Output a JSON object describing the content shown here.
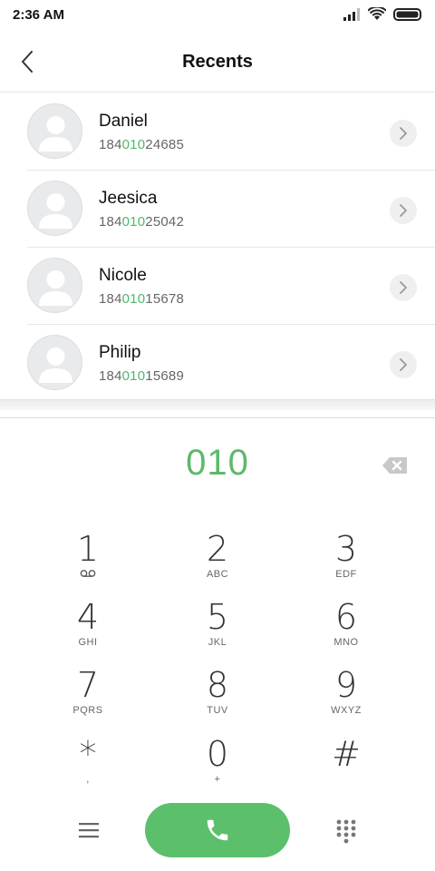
{
  "status": {
    "time": "2:36 AM",
    "icons": [
      "signal-icon",
      "wifi-icon",
      "battery-icon"
    ]
  },
  "header": {
    "title": "Recents",
    "back_icon": "chevron-left-icon"
  },
  "contacts": [
    {
      "name": "Daniel",
      "number_prefix": "184",
      "number_match": "010",
      "number_suffix": "24685"
    },
    {
      "name": "Jeesica",
      "number_prefix": "184",
      "number_match": "010",
      "number_suffix": "25042"
    },
    {
      "name": "Nicole",
      "number_prefix": "184",
      "number_match": "010",
      "number_suffix": "15678"
    },
    {
      "name": "Philip",
      "number_prefix": "184",
      "number_match": "010",
      "number_suffix": "15689"
    }
  ],
  "dialer": {
    "input": "010",
    "backspace_icon": "backspace-icon"
  },
  "keypad": [
    {
      "digit": "1",
      "letters": "",
      "icon": "voicemail-icon"
    },
    {
      "digit": "2",
      "letters": "ABC"
    },
    {
      "digit": "3",
      "letters": "EDF"
    },
    {
      "digit": "4",
      "letters": "GHI"
    },
    {
      "digit": "5",
      "letters": "JKL"
    },
    {
      "digit": "6",
      "letters": "MNO"
    },
    {
      "digit": "7",
      "letters": "PQRS"
    },
    {
      "digit": "8",
      "letters": "TUV"
    },
    {
      "digit": "9",
      "letters": "WXYZ"
    },
    {
      "digit": "*",
      "letters": ","
    },
    {
      "digit": "0",
      "letters": "+"
    },
    {
      "digit": "#",
      "letters": ""
    }
  ],
  "bottom": {
    "menu_icon": "menu-icon",
    "call_icon": "phone-icon",
    "dialpad_icon": "dialpad-icon"
  },
  "colors": {
    "accent_green": "#5cb96b",
    "call_button": "#5cbf6b"
  }
}
